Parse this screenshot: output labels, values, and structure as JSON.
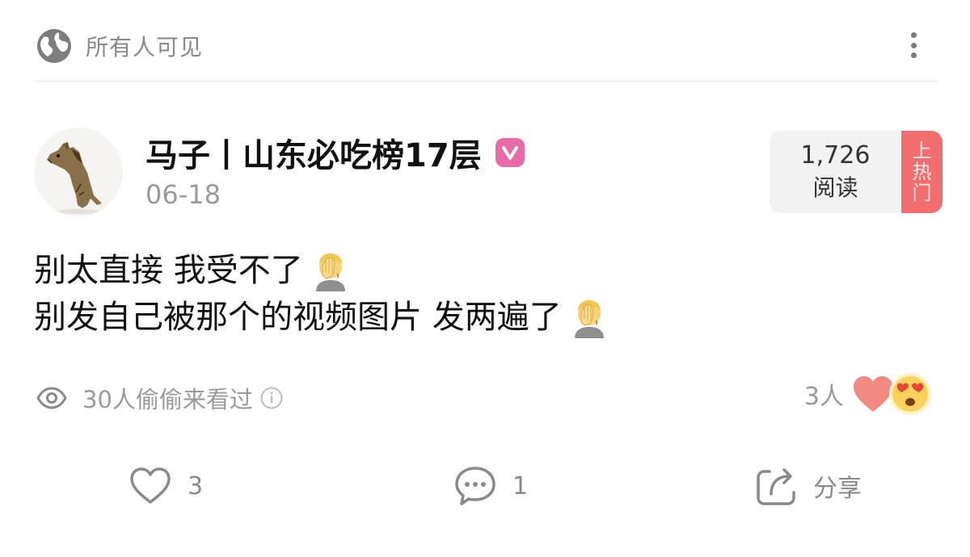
{
  "header": {
    "visibility": "所有人可见",
    "more_icon": "more-vertical-icon"
  },
  "post": {
    "author": "马子丨山东必吃榜17层",
    "verified_icon": "v-badge-icon",
    "date": "06-18",
    "read_count": "1,726",
    "read_label": "阅读",
    "hot_label": [
      "上",
      "热",
      "门"
    ],
    "lines": [
      "别太直接 我受不了",
      "别发自己被那个的视频图片 发两遍了"
    ],
    "emoji": "facepalm"
  },
  "stats": {
    "views_text": "30人偷偷来看过",
    "reaction_count": "3人"
  },
  "actions": {
    "like_count": "3",
    "comment_count": "1",
    "share_label": "分享"
  },
  "colors": {
    "accent_hot": "#f26d6d",
    "verified": "#e86aa6",
    "muted_text": "#9a9a9a"
  }
}
